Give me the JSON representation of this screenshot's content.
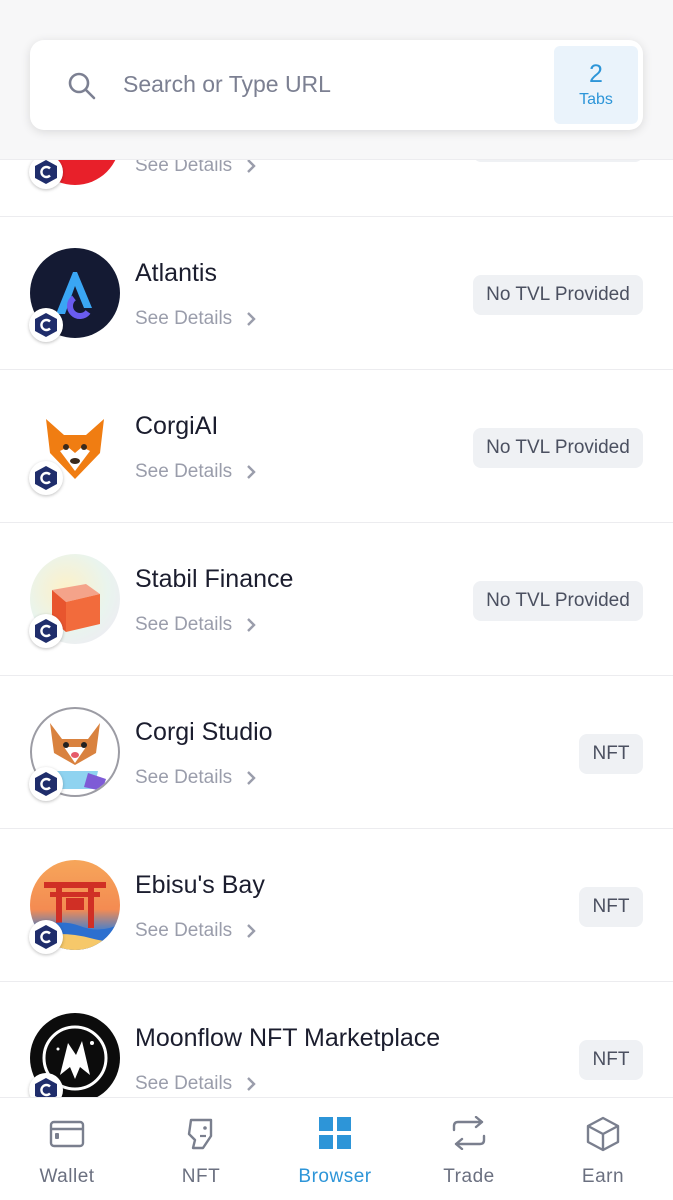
{
  "search": {
    "placeholder": "Search or Type URL"
  },
  "tabs": {
    "count": "2",
    "label": "Tabs"
  },
  "list": {
    "partial_item": {
      "details": "See Details"
    },
    "items": [
      {
        "name": "Atlantis",
        "details": "See Details",
        "tag": "No TVL Provided",
        "icon": "atlantis-logo"
      },
      {
        "name": "CorgiAI",
        "details": "See Details",
        "tag": "No TVL Provided",
        "icon": "corgi-fox-logo"
      },
      {
        "name": "Stabil Finance",
        "details": "See Details",
        "tag": "No TVL Provided",
        "icon": "orange-cube-logo"
      },
      {
        "name": "Corgi Studio",
        "details": "See Details",
        "tag": "NFT",
        "icon": "corgi-character-logo"
      },
      {
        "name": "Ebisu's Bay",
        "details": "See Details",
        "tag": "NFT",
        "icon": "pagoda-sunset-logo"
      },
      {
        "name": "Moonflow NFT Marketplace",
        "details": "See Details",
        "tag": "NFT",
        "icon": "wolf-moon-logo"
      }
    ]
  },
  "nav": {
    "items": [
      {
        "label": "Wallet",
        "icon": "wallet-icon"
      },
      {
        "label": "NFT",
        "icon": "nft-face-icon"
      },
      {
        "label": "Browser",
        "icon": "grid-icon"
      },
      {
        "label": "Trade",
        "icon": "swap-arrows-icon"
      },
      {
        "label": "Earn",
        "icon": "cube-icon"
      }
    ],
    "active": "Browser"
  },
  "colors": {
    "accent": "#2d95d8",
    "tag_bg": "#eff1f4",
    "text_muted": "#9a9dab",
    "badge_navy": "#1f2d6b"
  }
}
